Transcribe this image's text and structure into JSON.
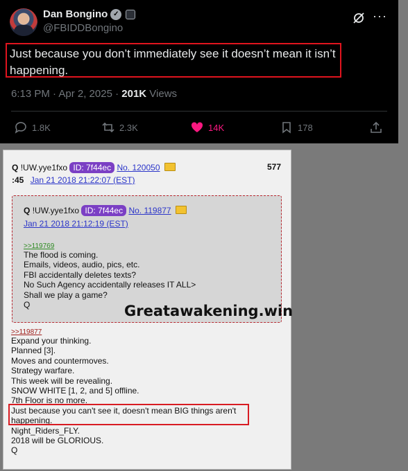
{
  "tweet": {
    "author_name": "Dan Bongino",
    "handle": "@FBIDDBongino",
    "text_line1": "Just because you don’t immediately see it doesn’t mean it isn’t",
    "text_line2": "happening.",
    "time": "6:13 PM · Apr 2, 2025 · ",
    "views_count": "201K",
    "views_label": " Views",
    "replies": "1.8K",
    "reposts": "2.3K",
    "likes": "14K",
    "bookmarks": "178",
    "colors": {
      "like": "#f91880",
      "highlight": "#e0141e",
      "muted": "#71767b"
    }
  },
  "qpost": {
    "author": "Q",
    "trip": "!UW.yye1fxo",
    "id": "ID: 7f44ec",
    "post_no": "No. 120050",
    "count": "577",
    "time_prefix": ":45",
    "time": "Jan 21 2018 21:22:07 (EST)",
    "quoted": {
      "author": "Q",
      "trip": "!UW.yye1fxo",
      "id": "ID: 7f44ec",
      "post_no": "No. 119877",
      "time": "Jan 21 2018 21:12:19 (EST)",
      "ref": ">>119769",
      "lines": [
        "The flood is coming.",
        "Emails, videos, audio, pics, etc.",
        "FBI accidentally deletes texts?",
        "No Such Agency accidentally releases IT ALL>",
        "Shall we play a game?",
        "Q"
      ],
      "watermark": "Greatawakening.win"
    },
    "ref": ">>119877",
    "lines": [
      "Expand your thinking.",
      "Planned [3].",
      "Moves and countermoves.",
      "Strategy warfare.",
      "This week will be revealing.",
      "SNOW WHITE [1, 2, and 5] offline.",
      "7th Floor is no more.",
      "Just because you can't see it, doesn't mean BIG things aren't",
      "happening.",
      "Night_Riders_FLY.",
      "2018 will be GLORIOUS.",
      "Q"
    ]
  }
}
